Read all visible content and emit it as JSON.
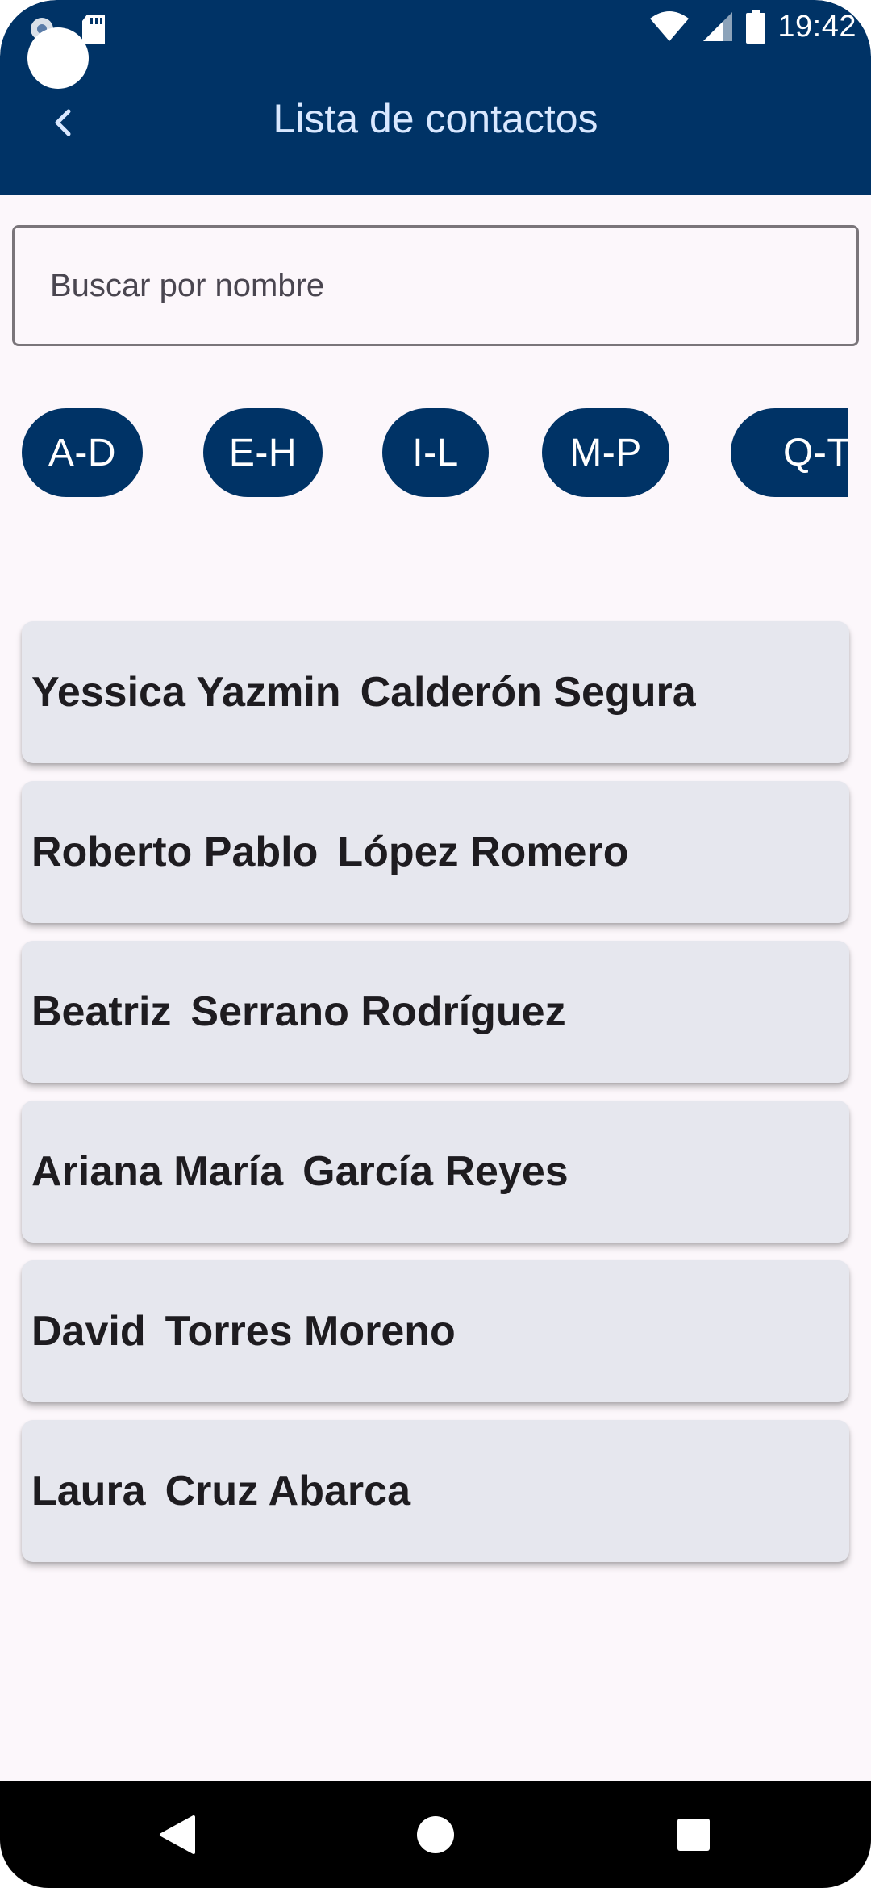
{
  "status_bar": {
    "time": "19:42",
    "icons": [
      "notification-icon",
      "sd-card-icon",
      "wifi-icon",
      "signal-icon",
      "battery-icon"
    ]
  },
  "app_bar": {
    "title": "Lista de contactos",
    "back_icon": "chevron-left-icon"
  },
  "search": {
    "placeholder": "Buscar por nombre",
    "value": ""
  },
  "filters": [
    {
      "label": "A-D"
    },
    {
      "label": "E-H"
    },
    {
      "label": "I-L"
    },
    {
      "label": "M-P"
    },
    {
      "label": "Q-T"
    }
  ],
  "contacts": [
    {
      "first": "Yessica Yazmin",
      "last": "Calderón Segura"
    },
    {
      "first": "Roberto Pablo",
      "last": "López Romero"
    },
    {
      "first": "Beatriz",
      "last": "Serrano Rodríguez"
    },
    {
      "first": "Ariana María",
      "last": "García Reyes"
    },
    {
      "first": "David",
      "last": "Torres Moreno"
    },
    {
      "first": "Laura",
      "last": "Cruz Abarca"
    }
  ],
  "nav_bar": {
    "buttons": [
      "back-triangle-icon",
      "home-circle-icon",
      "recents-square-icon"
    ]
  },
  "colors": {
    "primary": "#003366",
    "title_text": "#d9e8ff",
    "background": "#fcf7fb",
    "card": "#e6e7ee",
    "card_text": "#1e1c20"
  }
}
